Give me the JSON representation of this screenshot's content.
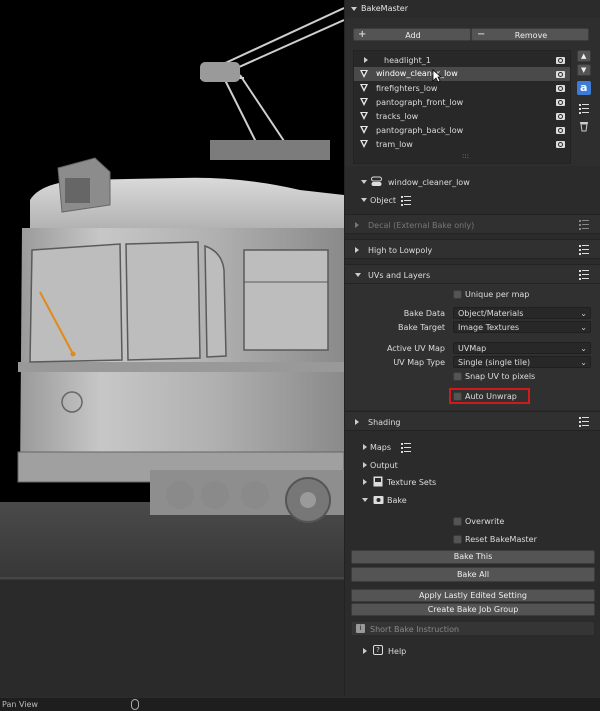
{
  "viewport": {
    "mode_label": "Pan View"
  },
  "panel": {
    "title": "BakeMaster",
    "add_label": "Add",
    "remove_label": "Remove",
    "objects": [
      {
        "name": "headlight_1",
        "selected": false,
        "expanded": false
      },
      {
        "name": "window_cleaner_low",
        "selected": true
      },
      {
        "name": "firefighters_low",
        "selected": false
      },
      {
        "name": "pantograph_front_low",
        "selected": false
      },
      {
        "name": "tracks_low",
        "selected": false
      },
      {
        "name": "pantograph_back_low",
        "selected": false
      },
      {
        "name": "tram_low",
        "selected": false
      }
    ],
    "grip_label": ":::",
    "active_object": "window_cleaner_low",
    "object_label": "Object",
    "decal_label": "Decal (External Bake only)",
    "high_to_lowpoly_label": "High to Lowpoly",
    "uvs_label": "UVs and Layers",
    "unique_per_map_label": "Unique per map",
    "bake_data_label": "Bake Data",
    "bake_data_value": "Object/Materials",
    "bake_target_label": "Bake Target",
    "bake_target_value": "Image Textures",
    "active_uv_label": "Active UV Map",
    "active_uv_value": "UVMap",
    "uv_type_label": "UV Map Type",
    "uv_type_value": "Single (single tile)",
    "snap_uv_label": "Snap UV to pixels",
    "auto_unwrap_label": "Auto Unwrap",
    "highlight_color": "#d11a1a",
    "shading_label": "Shading",
    "maps_label": "Maps",
    "output_label": "Output",
    "texture_sets_label": "Texture Sets",
    "bake_label": "Bake",
    "overwrite_label": "Overwrite",
    "reset_label": "Reset BakeMaster",
    "bake_this_label": "Bake This",
    "bake_all_label": "Bake All",
    "apply_label": "Apply Lastly Edited Setting",
    "create_job_label": "Create Bake Job Group",
    "instruction_label": "Short Bake Instruction",
    "help_label": "Help",
    "side_letter": "a"
  }
}
